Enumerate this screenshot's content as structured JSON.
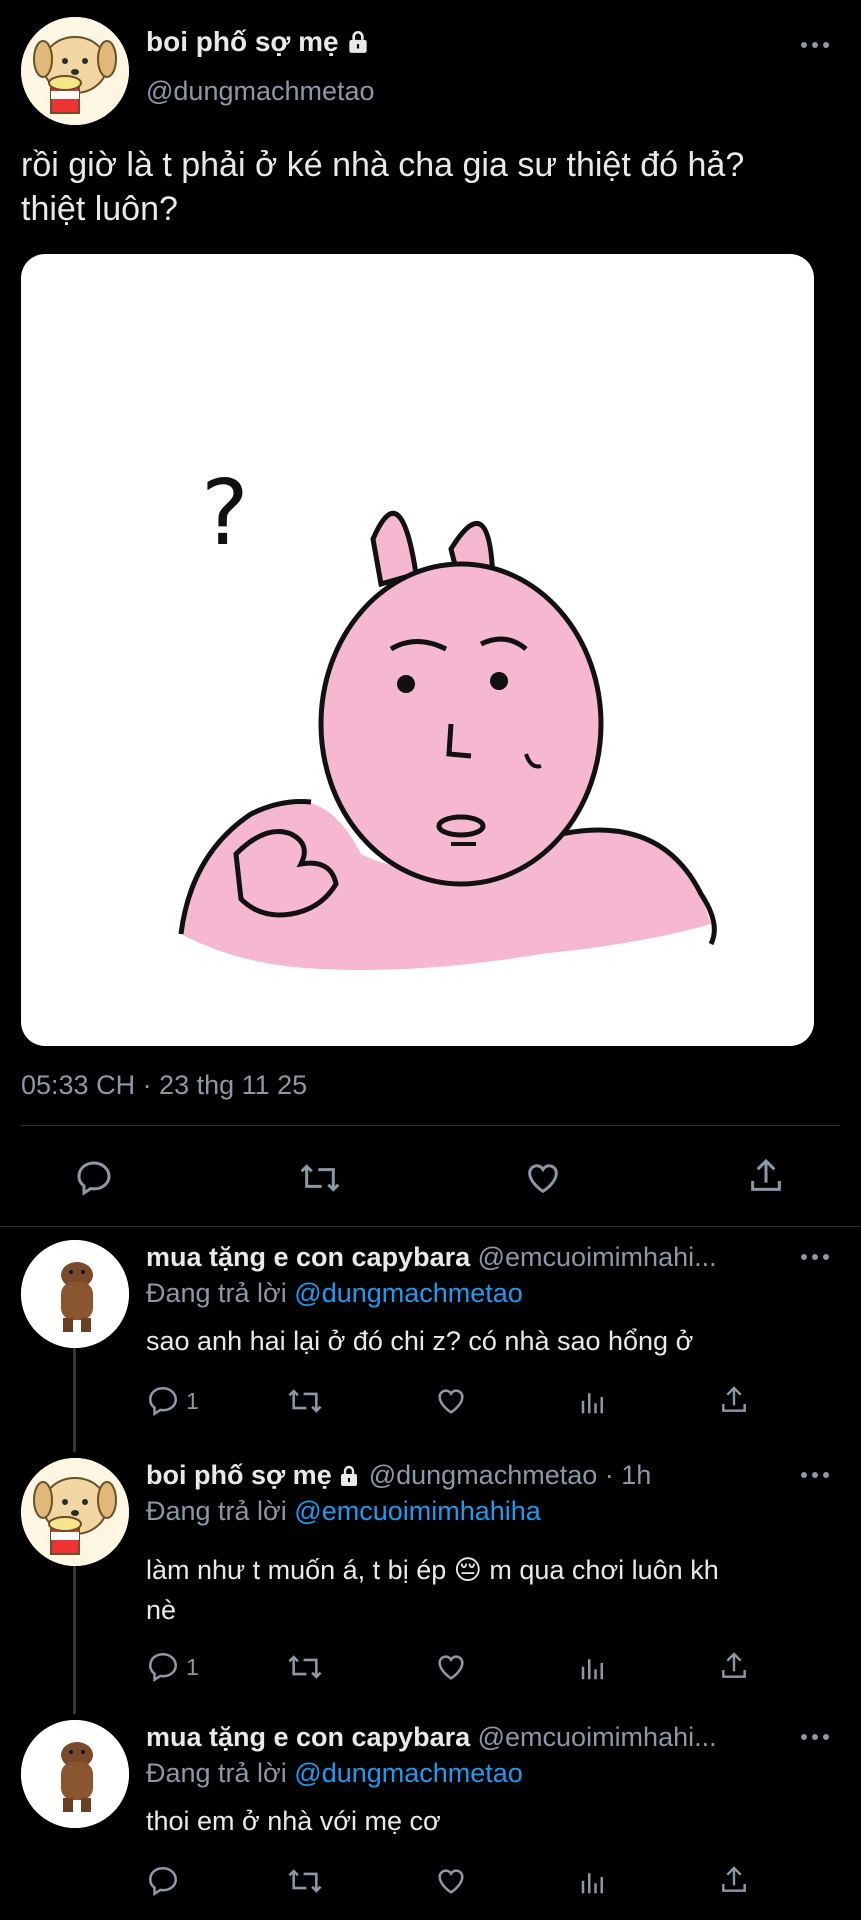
{
  "main_tweet": {
    "display_name": "boi phố sợ mẹ",
    "handle": "@dungmachmetao",
    "text_line1": "rồi giờ là t phải ở ké nhà cha gia sư thiệt đó hả?",
    "text_line2": "thiệt luôn?",
    "timestamp": "05:33 CH · 23 thg 11 25",
    "sticker_text": "?"
  },
  "replies": [
    {
      "display_name": "mua tặng e con capybara",
      "handle_trunc": "@emcuoimimhahi...",
      "replying_prefix": "Đang trả lời",
      "replying_to": "@dungmachmetao",
      "text": "sao anh hai lại ở đó chi z? có nhà sao hổng ở",
      "reply_count": "1"
    },
    {
      "display_name": "boi phố sợ mẹ",
      "handle_time": "@dungmachmetao · 1h",
      "replying_prefix": "Đang trả lời",
      "replying_to": "@emcuoimimhahiha",
      "text_line1": "làm như t muốn á, t bị ép 😔  m qua chơi luôn kh",
      "text_line2": "nè",
      "reply_count": "1"
    },
    {
      "display_name": "mua tặng e con capybara",
      "handle_trunc": "@emcuoimimhahi...",
      "replying_prefix": "Đang trả lời",
      "replying_to": "@dungmachmetao",
      "text": "thoi em ở nhà với mẹ cơ"
    }
  ],
  "icons": [
    "reply-icon",
    "retweet-icon",
    "like-icon",
    "share-icon",
    "analytics-icon",
    "more-icon",
    "lock-icon"
  ],
  "colors": {
    "background": "#000000",
    "text": "#e7e9ea",
    "secondary": "#8b98a5",
    "link": "#1d9bf0",
    "sticker_pink": "#f6b8d1"
  }
}
